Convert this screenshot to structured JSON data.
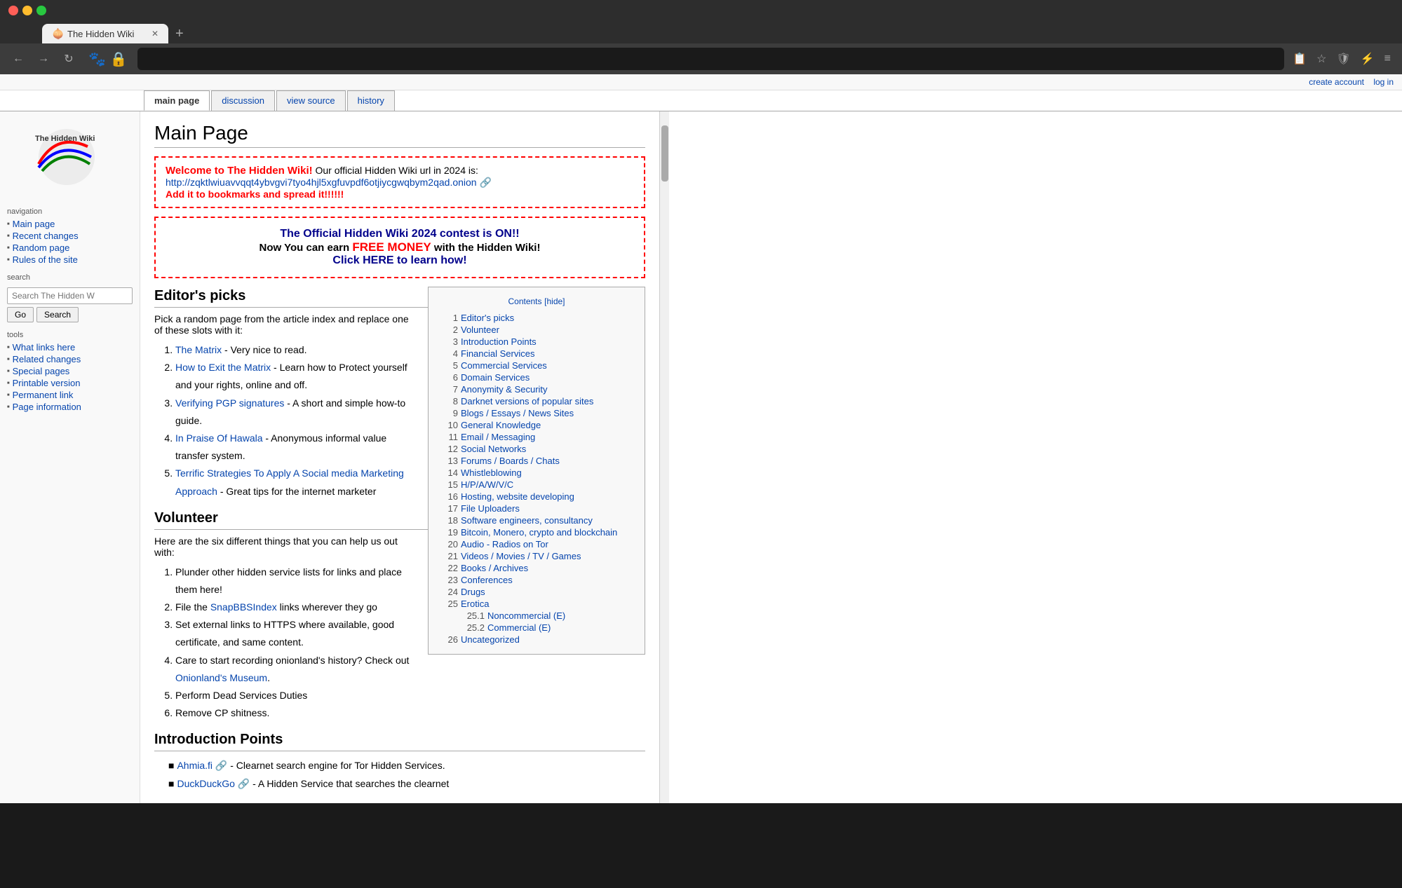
{
  "browser": {
    "tab_title": "The Hidden Wiki",
    "tab_favicon": "🧅",
    "new_tab_label": "+",
    "close_tab_label": "✕",
    "nav_back": "←",
    "nav_forward": "→",
    "nav_refresh": "↻",
    "address_bar_value": "",
    "nav_icons": [
      "☰",
      "☆",
      "🛡",
      "⚡",
      "≡"
    ]
  },
  "top_links": {
    "create_account": "create account",
    "log_in": "log in"
  },
  "wiki_tabs": [
    {
      "label": "main page",
      "active": true
    },
    {
      "label": "discussion",
      "active": false
    },
    {
      "label": "view source",
      "active": false
    },
    {
      "label": "history",
      "active": false
    }
  ],
  "sidebar": {
    "logo_line1": "The Hidden Wiki",
    "navigation_title": "navigation",
    "nav_items": [
      "Main page",
      "Recent changes",
      "Random page",
      "Rules of the site"
    ],
    "search_title": "search",
    "search_placeholder": "Search The Hidden W",
    "search_go_label": "Go",
    "search_search_label": "Search",
    "tools_title": "tools",
    "tools_items": [
      "What links here",
      "Related changes",
      "Special pages",
      "Printable version",
      "Permanent link",
      "Page information"
    ]
  },
  "page": {
    "title": "Main Page",
    "welcome_title": "Welcome to The Hidden Wiki!",
    "welcome_url_prefix": " Our official Hidden Wiki url in 2024 is: ",
    "welcome_url": "http://zqktlwiuavvqqt4ybvgvi7tyo4hjl5xgfuvpdf6otjiycgwqbym2qad.onion",
    "welcome_add": "Add it to bookmarks and spread it!!!!!!",
    "contest_title": "The Official Hidden Wiki 2024 contest is ON!!",
    "contest_line2_before": "Now You can earn ",
    "contest_free_money": "FREE MONEY",
    "contest_line2_after": " with the Hidden Wiki!",
    "contest_cta": "Click HERE to learn how!",
    "editors_picks_title": "Editor's picks",
    "editors_picks_desc": "Pick a random page from the article index and replace one of these slots with it:",
    "editors_picks_items": [
      {
        "link": "The Matrix",
        "desc": " - Very nice to read."
      },
      {
        "link": "How to Exit the Matrix",
        "desc": " - Learn how to Protect yourself and your rights, online and off."
      },
      {
        "link": "Verifying PGP signatures",
        "desc": " - A short and simple how-to guide."
      },
      {
        "link": "In Praise Of Hawala",
        "desc": " - Anonymous informal value transfer system."
      },
      {
        "link": "Terrific Strategies To Apply A Social media Marketing Approach",
        "desc": " - Great tips for the internet marketer"
      }
    ],
    "volunteer_title": "Volunteer",
    "volunteer_desc": "Here are the six different things that you can help us out with:",
    "volunteer_items": [
      "Plunder other hidden service lists for links and place them here!",
      "File the {SnapBBSIndex} links wherever they go",
      "Set external links to HTTPS where available, good certificate, and same content.",
      "Care to start recording onionland's history? Check out {Onionland's Museum}.",
      "Perform Dead Services Duties",
      "Remove CP shitness."
    ],
    "intro_points_title": "Introduction Points",
    "intro_items": [
      {
        "link": "Ahmia.fi",
        "desc": " - Clearnet search engine for Tor Hidden Services."
      },
      {
        "link": "DuckDuckGo",
        "desc": " - A Hidden Service that searches the clearnet"
      }
    ]
  },
  "toc": {
    "header": "Contents",
    "hide_label": "[hide]",
    "items": [
      {
        "num": "1",
        "label": "Editor's picks"
      },
      {
        "num": "2",
        "label": "Volunteer"
      },
      {
        "num": "3",
        "label": "Introduction Points"
      },
      {
        "num": "4",
        "label": "Financial Services"
      },
      {
        "num": "5",
        "label": "Commercial Services"
      },
      {
        "num": "6",
        "label": "Domain Services"
      },
      {
        "num": "7",
        "label": "Anonymity & Security"
      },
      {
        "num": "8",
        "label": "Darknet versions of popular sites"
      },
      {
        "num": "9",
        "label": "Blogs / Essays / News Sites"
      },
      {
        "num": "10",
        "label": "General Knowledge"
      },
      {
        "num": "11",
        "label": "Email / Messaging"
      },
      {
        "num": "12",
        "label": "Social Networks"
      },
      {
        "num": "13",
        "label": "Forums / Boards / Chats"
      },
      {
        "num": "14",
        "label": "Whistleblowing"
      },
      {
        "num": "15",
        "label": "H/P/A/W/V/C"
      },
      {
        "num": "16",
        "label": "Hosting, website developing"
      },
      {
        "num": "17",
        "label": "File Uploaders"
      },
      {
        "num": "18",
        "label": "Software engineers, consultancy"
      },
      {
        "num": "19",
        "label": "Bitcoin, Monero, crypto and blockchain"
      },
      {
        "num": "20",
        "label": "Audio - Radios on Tor"
      },
      {
        "num": "21",
        "label": "Videos / Movies / TV / Games"
      },
      {
        "num": "22",
        "label": "Books / Archives"
      },
      {
        "num": "23",
        "label": "Conferences"
      },
      {
        "num": "24",
        "label": "Drugs"
      },
      {
        "num": "25",
        "label": "Erotica"
      },
      {
        "num": "25.1",
        "label": "Noncommercial (E)",
        "sub": true
      },
      {
        "num": "25.2",
        "label": "Commercial (E)",
        "sub": true
      },
      {
        "num": "26",
        "label": "Uncategorized"
      }
    ]
  }
}
